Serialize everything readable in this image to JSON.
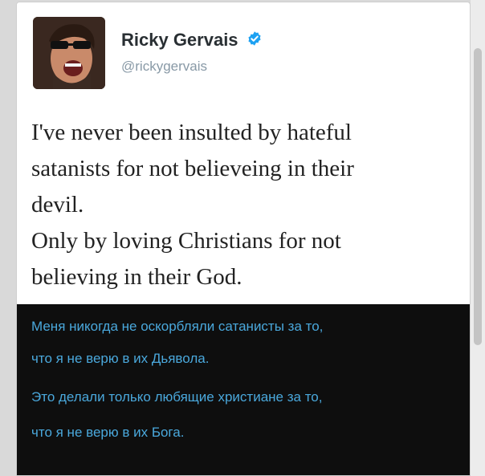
{
  "tweet": {
    "display_name": "Ricky Gervais",
    "handle": "@rickygervais",
    "text": "I've never been insulted by hateful\nsatanists for not believeing in their\ndevil.\nOnly by loving Christians for not\nbelieving in their God."
  },
  "translation": {
    "lines": [
      "Меня никогда не оскорбляли сатанисты за то,",
      "что я не верю в их Дьявола.",
      "Это делали только любящие христиане за то,",
      "что я не верю в их Бога."
    ]
  },
  "icons": {
    "verified": "verified-badge-icon",
    "avatar": "profile-photo"
  },
  "colors": {
    "verified_blue": "#1da1f2",
    "name": "#292f33",
    "handle": "#8899a6",
    "translation_bg": "#0e0e0e",
    "translation_text": "#4aa8dc"
  }
}
